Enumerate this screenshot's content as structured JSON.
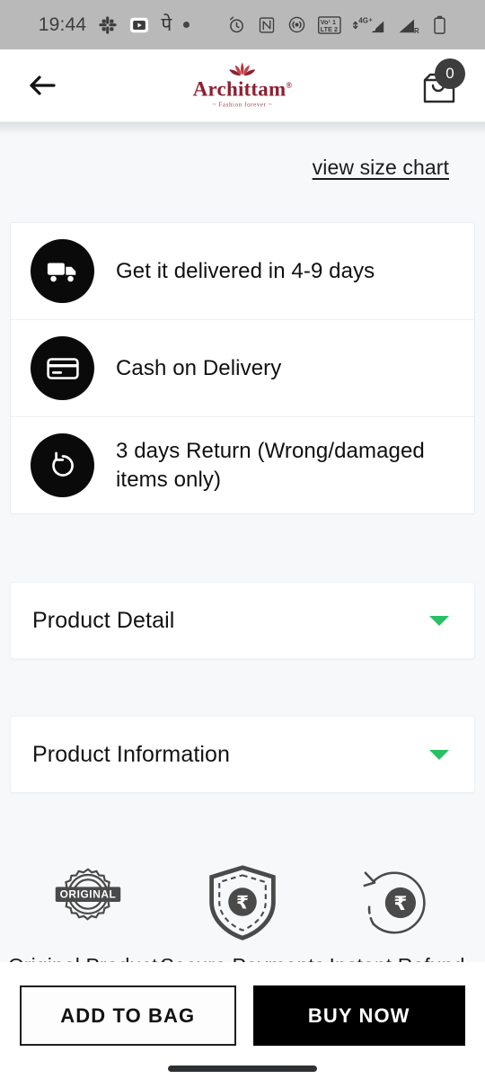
{
  "status_bar": {
    "time": "19:44",
    "left_icons": [
      "slack-icon",
      "video-player-icon",
      "phonepe-icon",
      "dot-icon"
    ],
    "right_icons": [
      "alarm-icon",
      "nfc-icon",
      "hotspot-icon",
      "volte-lte-icon",
      "signal-4g-plus-icon",
      "signal-roaming-icon",
      "battery-icon"
    ],
    "network_volte": "Vo¹ 1",
    "network_lte": "LTE 2",
    "network_gen": "4G",
    "roaming_label": "R",
    "background": "#b9b9b9"
  },
  "header": {
    "back_label": "Back",
    "brand_name": "Archittam",
    "brand_registered": "®",
    "brand_tagline": "~ Fashion forever ~",
    "brand_color": "#8d2030",
    "cart_count": "0"
  },
  "content": {
    "size_chart_link": "view size chart",
    "delivery_rows": [
      {
        "icon": "delivery-truck-icon",
        "text": "Get it delivered in 4-9 days"
      },
      {
        "icon": "credit-card-icon",
        "text": "Cash on Delivery"
      },
      {
        "icon": "return-arrow-icon",
        "text": "3 days Return (Wrong/damaged items only)"
      }
    ],
    "accordions": [
      {
        "title": "Product Detail",
        "caret": "chevron-down-icon",
        "expanded": "false"
      },
      {
        "title": "Product Information",
        "caret": "chevron-down-icon",
        "expanded": "false"
      }
    ],
    "accordion_caret_color": "#27c063",
    "trust_badges": [
      {
        "icon": "original-seal-icon",
        "badge_text": "ORIGINAL",
        "label": "Original Products"
      },
      {
        "icon": "shield-rupee-icon",
        "badge_text": "₹",
        "label": "Secure Payments"
      },
      {
        "icon": "refund-rupee-icon",
        "badge_text": "₹",
        "label": "Instant Refund"
      }
    ]
  },
  "bottom_bar": {
    "add_to_bag_label": "ADD TO BAG",
    "buy_now_label": "BUY NOW",
    "buy_now_bg": "#000000"
  }
}
